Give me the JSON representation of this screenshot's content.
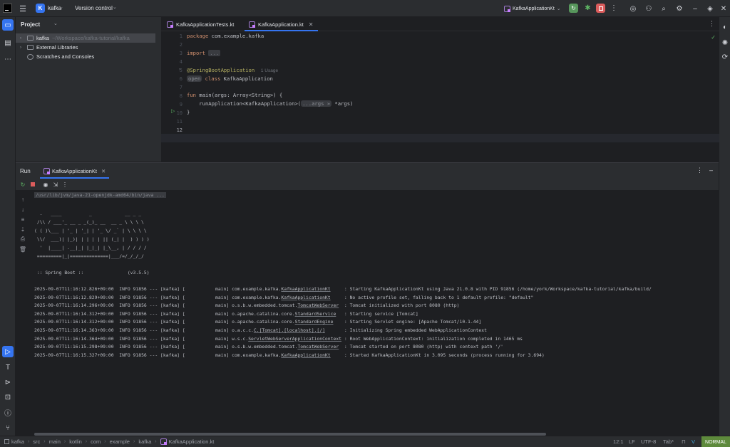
{
  "titlebar": {
    "project_initial": "K",
    "project_name": "kafka",
    "vcs_label": "Version control",
    "run_config": "KafkaApplicationKt"
  },
  "project_panel": {
    "title": "Project",
    "root_name": "kafka",
    "root_path": "~/Workspace/kafka-tutorial/kafka",
    "external_libraries": "External Libraries",
    "scratches": "Scratches and Consoles"
  },
  "editor": {
    "tabs": [
      {
        "label": "KafkaApplicationTests.kt"
      },
      {
        "label": "KafkaApplication.kt"
      }
    ],
    "line_numbers": [
      "1",
      "2",
      "3",
      "4",
      "5",
      "6",
      "7",
      "8",
      "9",
      "10",
      "11",
      "12"
    ],
    "code": {
      "l1_kw": "package",
      "l1_rest": " com.example.kafka",
      "l3_kw": "import",
      "l3_fold": "...",
      "l6_ann": "@SpringBootApplication",
      "l6_hint": "1 Usage",
      "l7_open": "open",
      "l7_kw": "class",
      "l7_rest": " KafkaApplication",
      "l9_kw": "fun",
      "l9_rest": " main(args: Array<String>) {",
      "l10_pre": "    runApplication<KafkaApplication>(",
      "l10_inlay": "...args »",
      "l10_post": " *args)",
      "l11": "}"
    }
  },
  "run_panel": {
    "title": "Run",
    "tab_label": "KafkaApplicationKt",
    "java_cmd": "/usr/lib/jvm/java-21-openjdk-amd64/bin/java ...",
    "banner": [
      "  .   ____          _            __ _ _",
      " /\\\\ / ___'_ __ _ _(_)_ __  __ _ \\ \\ \\ \\",
      "( ( )\\___ | '_ | '_| | '_ \\/ _` | \\ \\ \\ \\",
      " \\\\/  ___)| |_)| | | | | || (_| |  ) ) ) )",
      "  '  |____| .__|_| |_|_| |_\\__, | / / / /",
      " =========|_|==============|___/=/_/_/_/"
    ],
    "spring_boot": " :: Spring Boot ::                (v3.5.5)",
    "logs": [
      {
        "ts": "2025-09-07T11:16:12.826+09:00",
        "level": "INFO",
        "pid": "91856",
        "app": "[kafka]",
        "thread": "[           main]",
        "logger_pre": "com.example.kafka.",
        "logger_cls": "KafkaApplicationKt",
        "pad": "     ",
        "msg": ": Starting KafkaApplicationKt using Java 21.0.8 with PID 91856 (/home/york/Workspace/kafka-tutorial/kafka/build/"
      },
      {
        "ts": "2025-09-07T11:16:12.829+09:00",
        "level": "INFO",
        "pid": "91856",
        "app": "[kafka]",
        "thread": "[           main]",
        "logger_pre": "com.example.kafka.",
        "logger_cls": "KafkaApplicationKt",
        "pad": "     ",
        "msg": ": No active profile set, falling back to 1 default profile: \"default\""
      },
      {
        "ts": "2025-09-07T11:16:14.296+09:00",
        "level": "INFO",
        "pid": "91856",
        "app": "[kafka]",
        "thread": "[           main]",
        "logger_pre": "o.s.b.w.embedded.tomcat.",
        "logger_cls": "TomcatWebServer",
        "pad": "  ",
        "msg": ": Tomcat initialized with port 8080 (http)"
      },
      {
        "ts": "2025-09-07T11:16:14.312+09:00",
        "level": "INFO",
        "pid": "91856",
        "app": "[kafka]",
        "thread": "[           main]",
        "logger_pre": "o.apache.catalina.core.",
        "logger_cls": "StandardService",
        "pad": "   ",
        "msg": ": Starting service [Tomcat]"
      },
      {
        "ts": "2025-09-07T11:16:14.312+09:00",
        "level": "INFO",
        "pid": "91856",
        "app": "[kafka]",
        "thread": "[           main]",
        "logger_pre": "o.apache.catalina.core.",
        "logger_cls": "StandardEngine",
        "pad": "    ",
        "msg": ": Starting Servlet engine: [Apache Tomcat/10.1.44]"
      },
      {
        "ts": "2025-09-07T11:16:14.363+09:00",
        "level": "INFO",
        "pid": "91856",
        "app": "[kafka]",
        "thread": "[           main]",
        "logger_pre": "o.a.c.c.",
        "logger_cls": "C.[Tomcat].[localhost].[/]",
        "pad": "       ",
        "msg": ": Initializing Spring embedded WebApplicationContext"
      },
      {
        "ts": "2025-09-07T11:16:14.364+09:00",
        "level": "INFO",
        "pid": "91856",
        "app": "[kafka]",
        "thread": "[           main]",
        "logger_pre": "w.s.c.",
        "logger_cls": "ServletWebServerApplicationContext",
        "pad": " ",
        "msg": ": Root WebApplicationContext: initialization completed in 1465 ms"
      },
      {
        "ts": "2025-09-07T11:16:15.298+09:00",
        "level": "INFO",
        "pid": "91856",
        "app": "[kafka]",
        "thread": "[           main]",
        "logger_pre": "o.s.b.w.embedded.tomcat.",
        "logger_cls": "TomcatWebServer",
        "pad": "  ",
        "msg": ": Tomcat started on port 8080 (http) with context path '/'"
      },
      {
        "ts": "2025-09-07T11:16:15.327+09:00",
        "level": "INFO",
        "pid": "91856",
        "app": "[kafka]",
        "thread": "[           main]",
        "logger_pre": "com.example.kafka.",
        "logger_cls": "KafkaApplicationKt",
        "pad": "     ",
        "msg": ": Started KafkaApplicationKt in 3.095 seconds (process running for 3.694)"
      }
    ]
  },
  "statusbar": {
    "breadcrumbs": [
      "kafka",
      "src",
      "main",
      "kotlin",
      "com",
      "example",
      "kafka",
      "KafkaApplication.kt"
    ],
    "position": "12:1",
    "line_sep": "LF",
    "encoding": "UTF-8",
    "indent": "Tab*",
    "mode": "NORMAL"
  },
  "colors": {
    "accent": "#3574f0",
    "run_green": "#57965c",
    "stop_red": "#db5c5c",
    "mode_green": "#5e8a3c"
  }
}
